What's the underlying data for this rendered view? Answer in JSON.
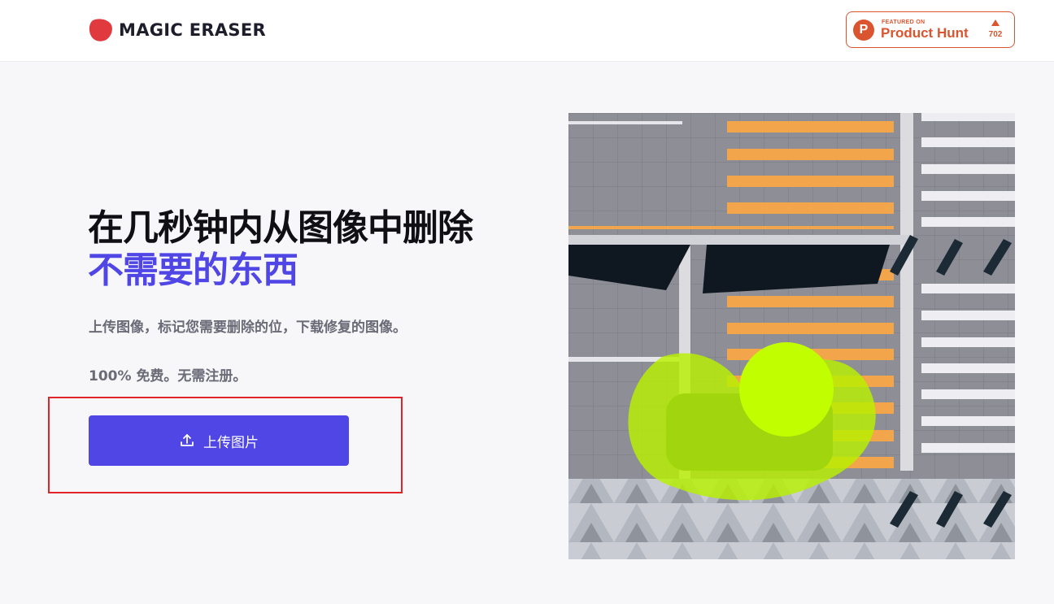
{
  "header": {
    "logo_text": "MAGIC ERASER",
    "product_hunt": {
      "featured_label": "FEATURED ON",
      "name": "Product Hunt",
      "upvotes": "702",
      "color": "#da552f"
    }
  },
  "hero": {
    "title_line1": "在几秒钟内从图像中删除",
    "title_line2": "不需要的东西",
    "subtitle": "上传图像，标记您需要删除的位，下载修复的图像。",
    "free_note": "100% 免费。无需注册。",
    "upload_button_label": "上传图片"
  },
  "colors": {
    "accent": "#4f46e5",
    "brand_red": "#e0393e",
    "highlight_border": "#e0242a",
    "mask_green": "#b8f000"
  },
  "icons": {
    "logo": "magic-eraser-logo-icon",
    "upload": "upload-icon",
    "product_hunt": "product-hunt-logo-icon",
    "upvote": "upvote-arrow-icon"
  }
}
